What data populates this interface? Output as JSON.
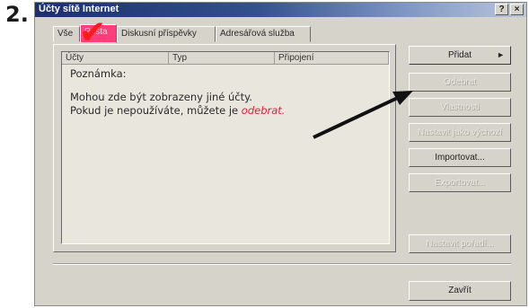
{
  "step_number": "2.",
  "window": {
    "title": "Účty sítě Internet",
    "help_button": "?",
    "close_button": "×"
  },
  "tabs": [
    {
      "label": "Vše",
      "active": false
    },
    {
      "label": "Pošta",
      "active": true
    },
    {
      "label": "Diskusní příspěvky",
      "active": false
    },
    {
      "label": "Adresářová služba",
      "active": false
    }
  ],
  "list": {
    "columns": [
      "Účty",
      "Typ",
      "Připojení"
    ],
    "note_title": "Poznámka:",
    "note_line1": "Mohou zde být zobrazeny jiné účty.",
    "note_line2_prefix": "Pokud je nepoužíváte, můžete je ",
    "note_line2_link": "odebrat."
  },
  "buttons": {
    "add": "Přidat",
    "add_arrow": "►",
    "remove": "Odebrat",
    "properties": "Vlastnosti",
    "set_default": "Nastavit jako výchozí",
    "import": "Importovat...",
    "export": "Exportovat...",
    "order": "Nastavit pořadí...",
    "close": "Zavřít"
  },
  "colors": {
    "accent_red": "#e0203a",
    "titlebar_dark": "#1c2f6e",
    "active_tab": "#ff3f7a"
  }
}
